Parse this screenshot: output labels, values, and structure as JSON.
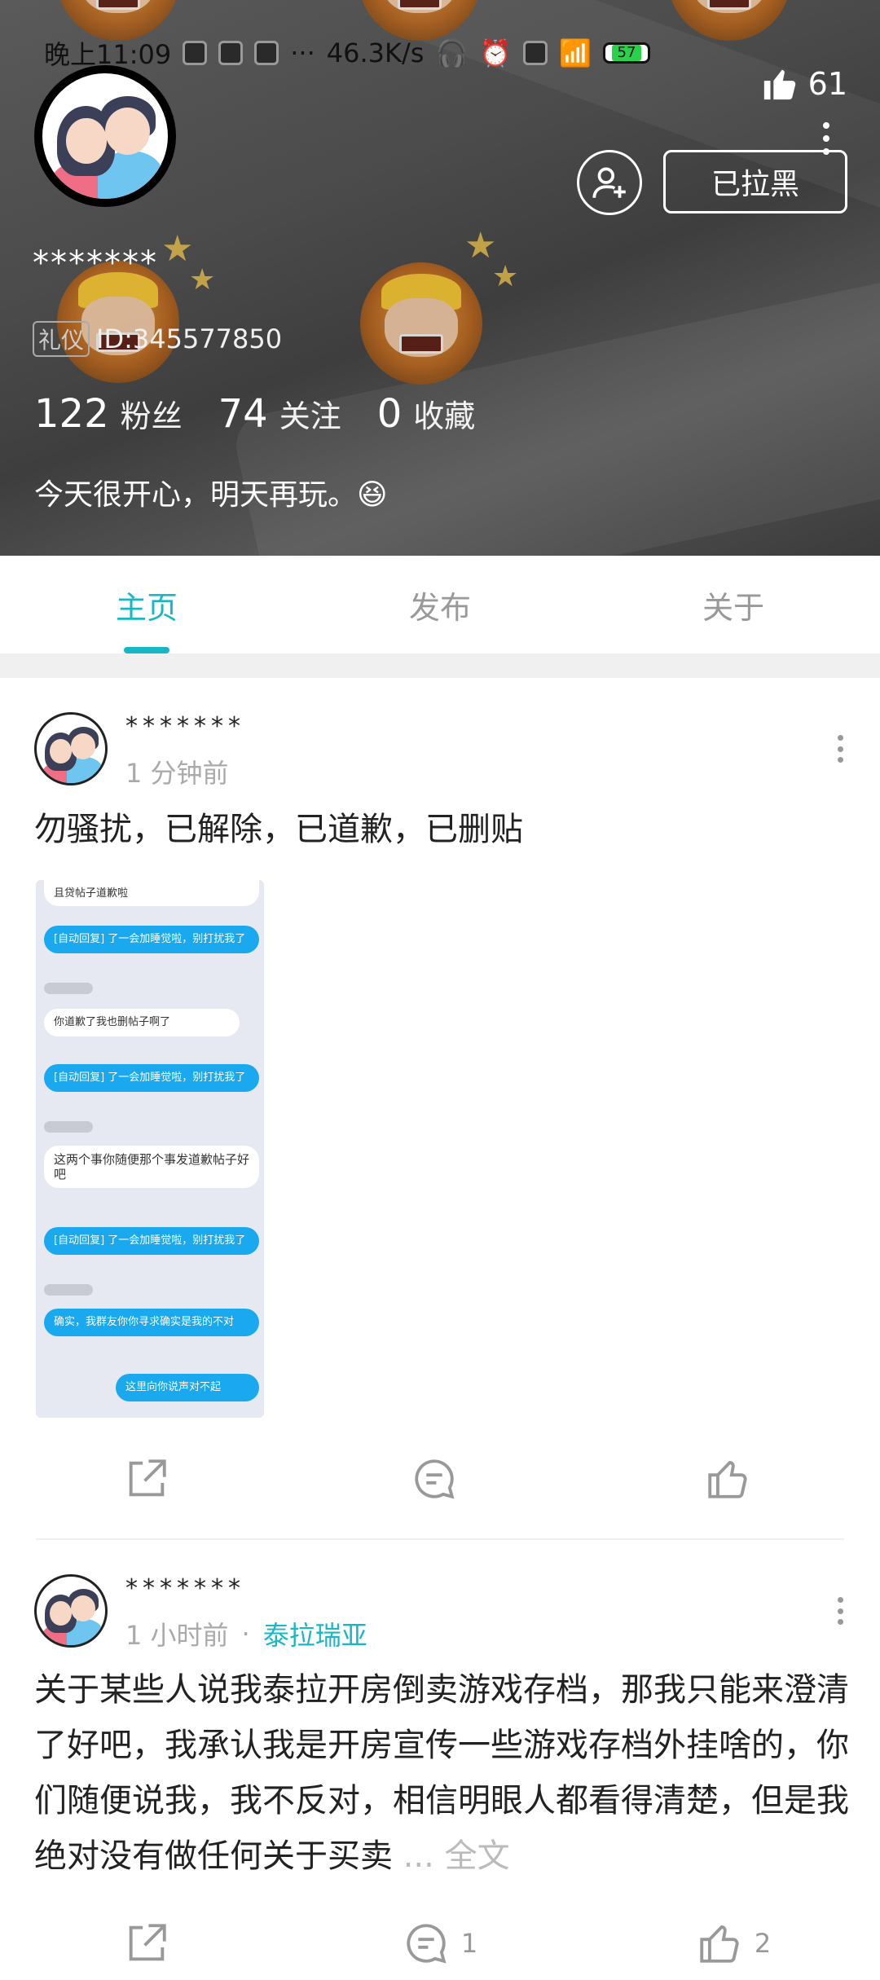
{
  "status_bar": {
    "time": "晚上11:09",
    "dots": "···",
    "speed": "46.3K/s",
    "battery": "57"
  },
  "profile": {
    "likes_count": "61",
    "nickname": "*******",
    "id_tag": "礼仪",
    "id_text": "ID:345577850",
    "blocked_label": "已拉黑",
    "stats": {
      "fans_count": "122",
      "fans_label": "粉丝",
      "follow_count": "74",
      "follow_label": "关注",
      "fav_count": "0",
      "fav_label": "收藏"
    },
    "bio": "今天很开心，明天再玩。😆"
  },
  "tabs": [
    {
      "label": "主页",
      "active": true
    },
    {
      "label": "发布",
      "active": false
    },
    {
      "label": "关于",
      "active": false
    }
  ],
  "posts": [
    {
      "author": "*******",
      "time": "1 分钟前",
      "text": "勿骚扰，已解除，已道歉，已删贴",
      "screenshot": {
        "messages": [
          "且贷帖子道歉啦",
          "[自动回复] 了一会加睡觉啦，别打扰我了",
          "你道歉了我也删帖子啊了",
          "[自动回复] 了一会加睡觉啦，别打扰我了",
          "这两个事你随便那个事发道歉帖子好吧",
          "[自动回复] 了一会加睡觉啦，别打扰我了",
          "确实，我群友你你寻求确实是我的不对",
          "这里向你说声对不起"
        ]
      },
      "comments": "",
      "likes": ""
    },
    {
      "author": "*******",
      "time": "1 小时前",
      "separator": "·",
      "tag": "泰拉瑞亚",
      "text": "关于某些人说我泰拉开房倒卖游戏存档，那我只能来澄清了好吧，我承认我是开房宣传一些游戏存档外挂啥的，你们随便说我，我不反对，相信明眼人都看得清楚，但是我绝对没有做任何关于买卖",
      "more": "... 全文",
      "comments": "1",
      "likes": "2"
    }
  ],
  "icons": [
    "thumbs-up-icon",
    "more-vertical-icon",
    "add-user-icon",
    "share-icon",
    "comment-icon",
    "like-icon"
  ],
  "colors": {
    "accent": "#17b7c6",
    "header_bg": "#4a4a4a"
  }
}
